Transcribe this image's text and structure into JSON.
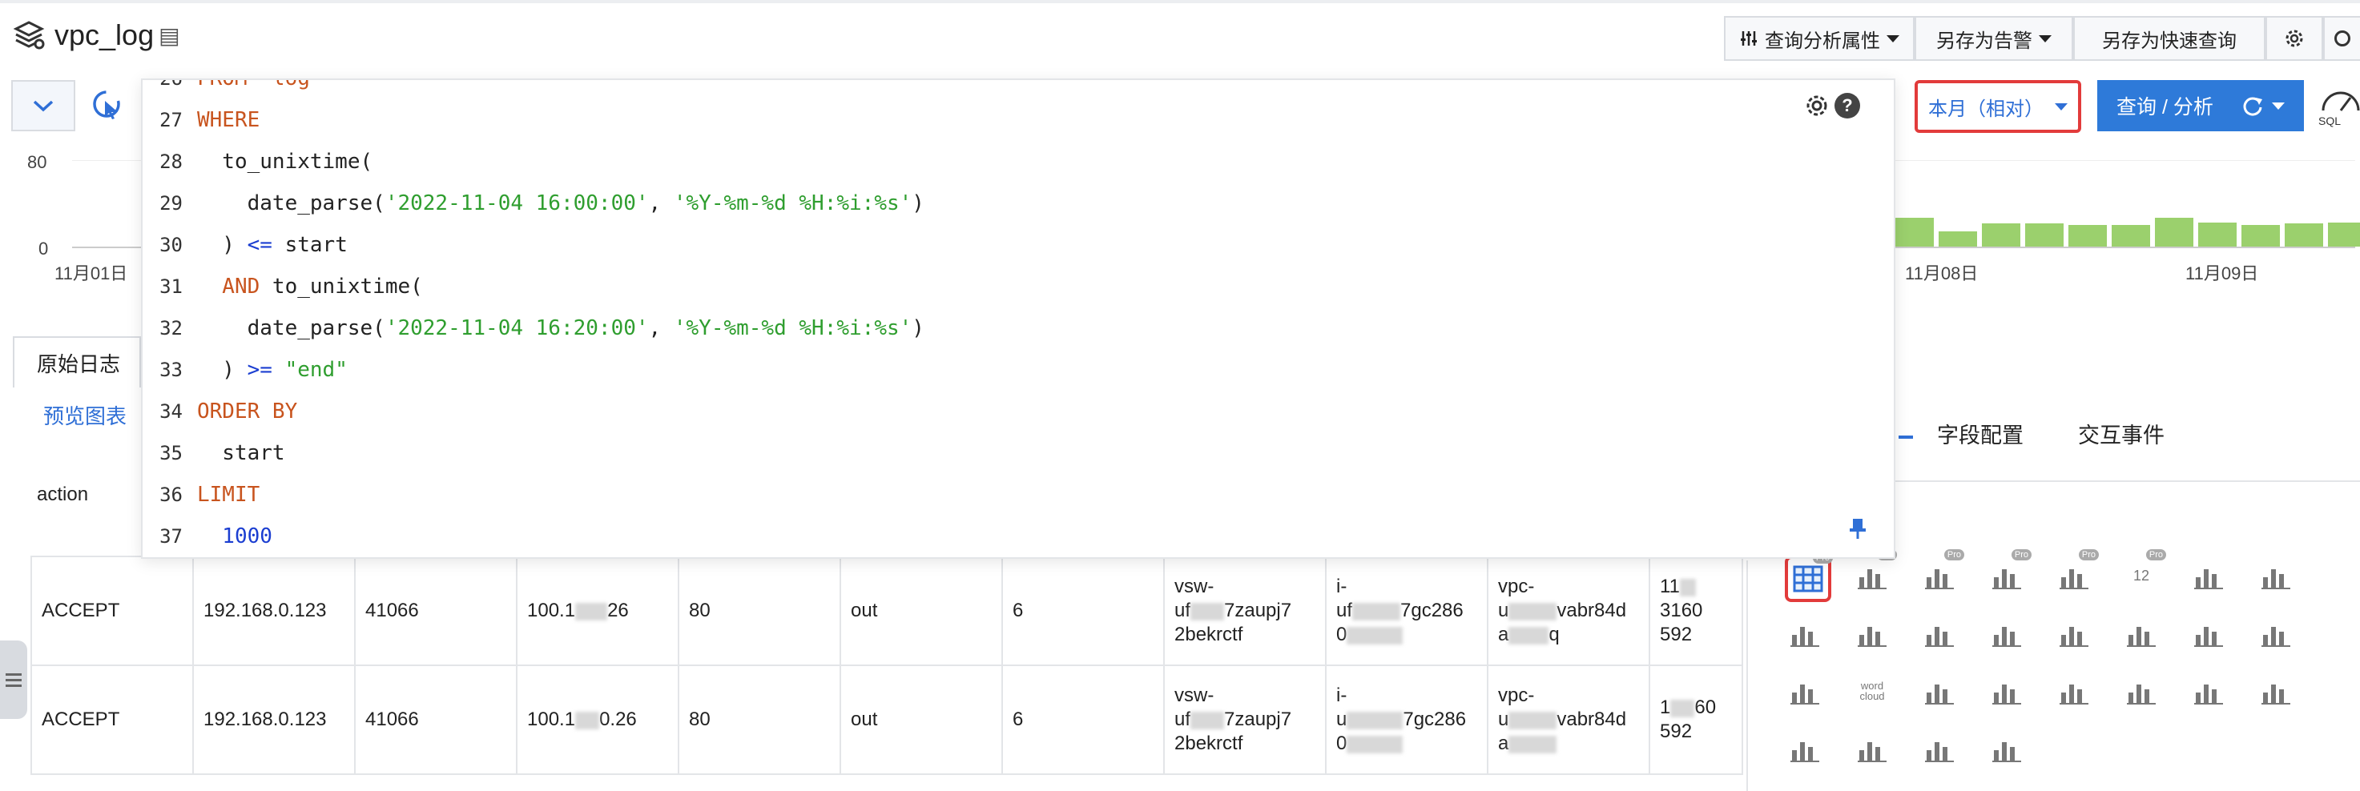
{
  "header": {
    "title": "vpc_log",
    "buttons": {
      "analysis_props": "查询分析属性",
      "save_alert": "另存为告警",
      "save_quick_query": "另存为快速查询"
    }
  },
  "query_bar": {
    "time_range": "本月（相对）",
    "query_button": "查询 / 分析",
    "sql_badge": "SQL"
  },
  "histogram": {
    "y_ticks": [
      "80",
      "0"
    ],
    "x_ticks": [
      "11月01日",
      "11月08日",
      "11月09日"
    ]
  },
  "sql_editor": {
    "partial_first_line": "FROM  log",
    "lines": [
      {
        "n": "27",
        "tokens": [
          {
            "t": "WHERE",
            "c": "kw"
          }
        ]
      },
      {
        "n": "28",
        "tokens": [
          {
            "t": "  to_unixtime(",
            "c": "fn"
          }
        ]
      },
      {
        "n": "29",
        "tokens": [
          {
            "t": "    date_parse(",
            "c": "fn"
          },
          {
            "t": "'2022-11-04 16:00:00'",
            "c": "str"
          },
          {
            "t": ", ",
            "c": "fn"
          },
          {
            "t": "'%Y-%m-%d %H:%i:%s'",
            "c": "str"
          },
          {
            "t": ")",
            "c": "fn"
          }
        ]
      },
      {
        "n": "30",
        "tokens": [
          {
            "t": "  ) ",
            "c": "fn"
          },
          {
            "t": "<=",
            "c": "op"
          },
          {
            "t": " start",
            "c": "fn"
          }
        ]
      },
      {
        "n": "31",
        "tokens": [
          {
            "t": "  AND",
            "c": "kw"
          },
          {
            "t": " to_unixtime(",
            "c": "fn"
          }
        ]
      },
      {
        "n": "32",
        "tokens": [
          {
            "t": "    date_parse(",
            "c": "fn"
          },
          {
            "t": "'2022-11-04 16:20:00'",
            "c": "str"
          },
          {
            "t": ", ",
            "c": "fn"
          },
          {
            "t": "'%Y-%m-%d %H:%i:%s'",
            "c": "str"
          },
          {
            "t": ")",
            "c": "fn"
          }
        ]
      },
      {
        "n": "33",
        "tokens": [
          {
            "t": "  ) ",
            "c": "fn"
          },
          {
            "t": ">=",
            "c": "op"
          },
          {
            "t": " ",
            "c": "fn"
          },
          {
            "t": "\"end\"",
            "c": "dq"
          }
        ]
      },
      {
        "n": "34",
        "tokens": [
          {
            "t": "ORDER BY",
            "c": "kw"
          }
        ]
      },
      {
        "n": "35",
        "tokens": [
          {
            "t": "  start",
            "c": "fn"
          }
        ]
      },
      {
        "n": "36",
        "tokens": [
          {
            "t": "LIMIT",
            "c": "kw"
          }
        ]
      },
      {
        "n": "37",
        "tokens": [
          {
            "t": "  1000",
            "c": "num"
          }
        ]
      }
    ]
  },
  "tabs": {
    "raw_logs": "原始日志",
    "preview_chart": "预览图表"
  },
  "table": {
    "first_header": "action",
    "rows": [
      [
        "ACCEPT",
        "192.168.0.123",
        "41066",
        "100.1",
        "26",
        "80",
        "out",
        "6",
        "vsw-",
        "uf",
        "7zaupj7",
        "2bekrctf",
        "i-",
        "uf",
        "7gc286",
        "0",
        "vpc-",
        "u",
        "vabr84d",
        "a",
        "q",
        "11",
        "3160",
        "592"
      ],
      [
        "ACCEPT",
        "192.168.0.123",
        "41066",
        "100.1",
        "0.26",
        "80",
        "out",
        "6",
        "vsw-",
        "uf",
        "7zaupj7",
        "2bekrctf",
        "i-",
        "u",
        "7gc286",
        "0",
        "vpc-",
        "u",
        "vabr84d",
        "a",
        "",
        "1",
        "60",
        "592"
      ]
    ]
  },
  "right_panel": {
    "tabs": [
      "字段配置",
      "交互事件"
    ],
    "icon_pro_label": "Pro",
    "word_cloud_label": "word cloud",
    "digit_label": "12"
  }
}
